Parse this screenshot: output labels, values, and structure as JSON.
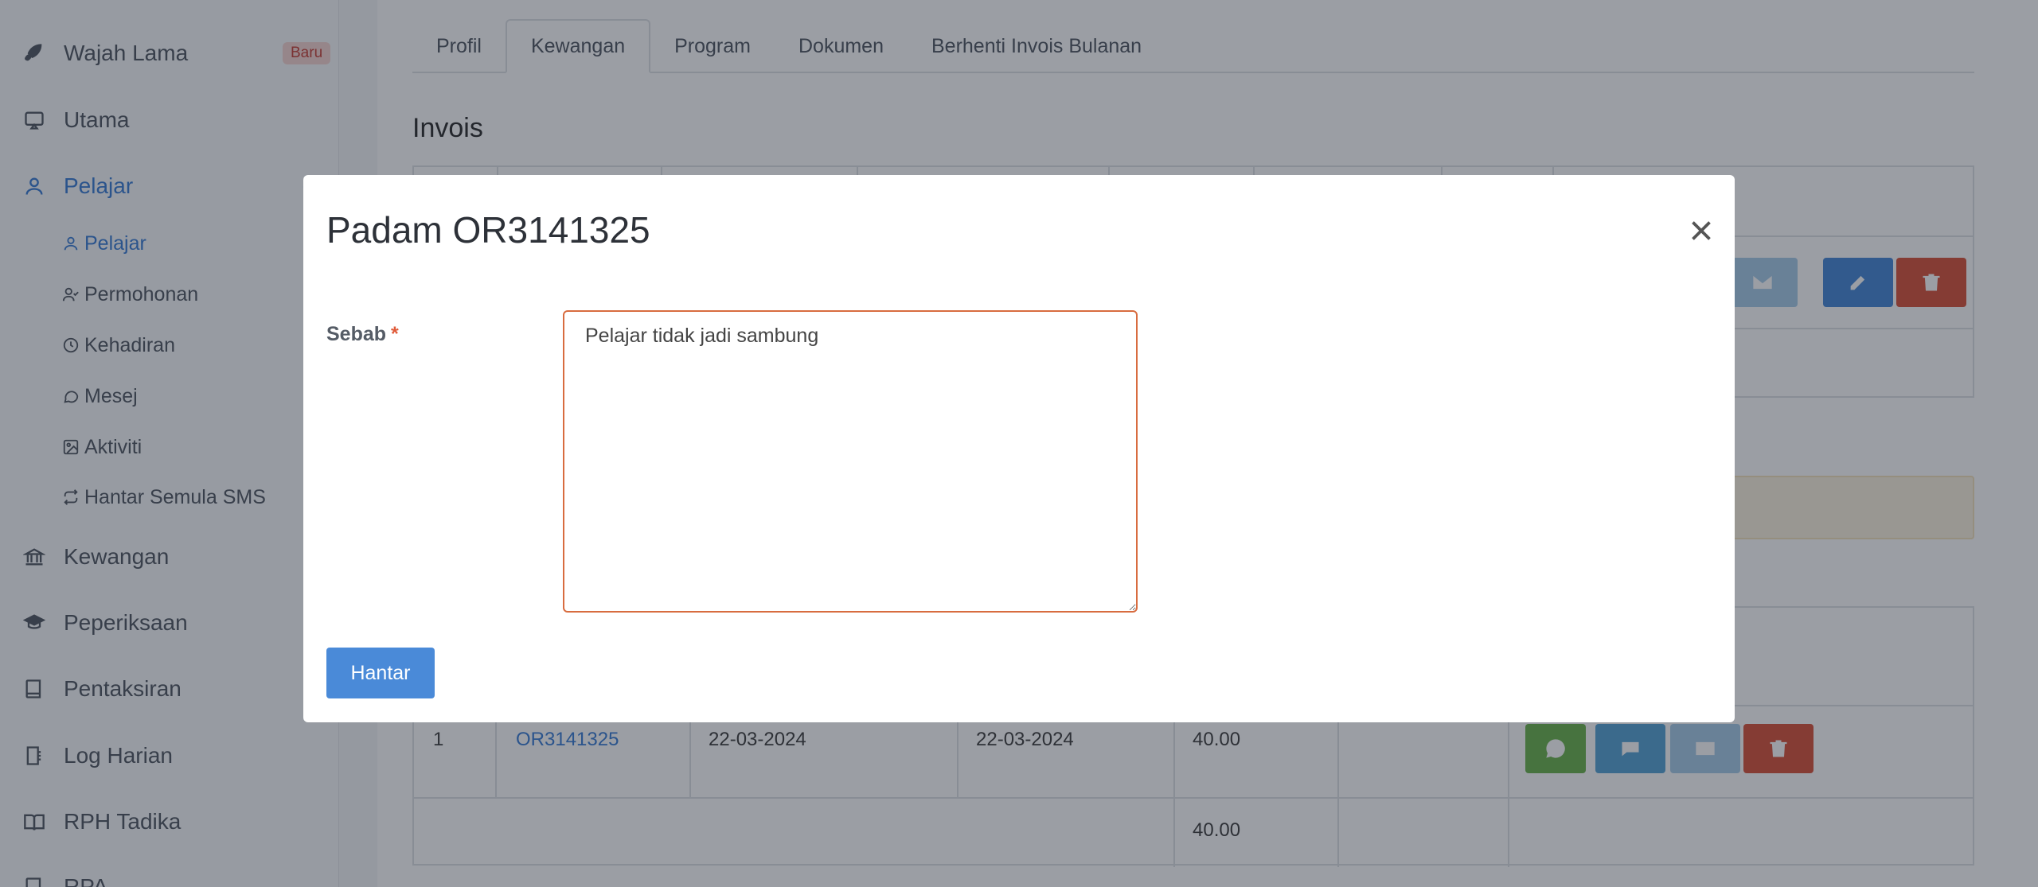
{
  "sidebar": {
    "items": [
      {
        "label": "Wajah Lama",
        "badge": "Baru",
        "icon": "rocket-icon"
      },
      {
        "label": "Utama",
        "icon": "monitor-icon"
      },
      {
        "label": "Pelajar",
        "icon": "user-icon"
      },
      {
        "label": "Kewangan",
        "icon": "bank-icon"
      },
      {
        "label": "Peperiksaan",
        "icon": "graduation-cap-icon"
      },
      {
        "label": "Pentaksiran",
        "icon": "book-icon"
      },
      {
        "label": "Log Harian",
        "icon": "log-book-icon"
      },
      {
        "label": "RPH Tadika",
        "icon": "open-book-icon"
      },
      {
        "label": "RPA",
        "icon": "book-icon"
      }
    ],
    "sub_items": [
      {
        "label": "Pelajar",
        "icon": "user-icon"
      },
      {
        "label": "Permohonan",
        "icon": "user-check-icon"
      },
      {
        "label": "Kehadiran",
        "icon": "clock-icon"
      },
      {
        "label": "Mesej",
        "icon": "chat-icon"
      },
      {
        "label": "Aktiviti",
        "icon": "image-icon"
      },
      {
        "label": "Hantar Semula SMS",
        "icon": "repeat-icon"
      }
    ]
  },
  "main": {
    "tabs": [
      {
        "label": "Profil"
      },
      {
        "label": "Kewangan"
      },
      {
        "label": "Program"
      },
      {
        "label": "Dokumen"
      },
      {
        "label": "Berhenti Invois Bulanan"
      }
    ],
    "section_title": "Invois",
    "receipt_row": {
      "no": "1",
      "code": "OR3141325",
      "date1": "22-03-2024",
      "date2": "22-03-2024",
      "amount": "40.00"
    },
    "total": "40.00"
  },
  "modal": {
    "title": "Padam OR3141325",
    "field_label": "Sebab",
    "required_mark": "*",
    "textarea_value": "Pelajar tidak jadi sambung",
    "submit_label": "Hantar"
  },
  "colors": {
    "primary": "#4a8ad8",
    "danger": "#d9573f",
    "success": "#5cb85c",
    "info": "#5bc0de",
    "input_border": "#d86c3f"
  }
}
